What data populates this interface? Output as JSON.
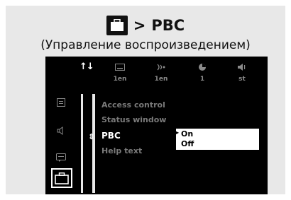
{
  "title": {
    "separator": ">",
    "label": "PBC",
    "subtitle": "(Управление воспроизведением)",
    "icon": "briefcase-icon"
  },
  "topbar": {
    "settings_label": "↑↓",
    "columns": [
      {
        "icon": "subtitle-icon",
        "value": "1en"
      },
      {
        "icon": "audio-language-icon",
        "value": "1en"
      },
      {
        "icon": "angle-icon",
        "value": "1"
      },
      {
        "icon": "sound-mode-icon",
        "value": "st"
      }
    ]
  },
  "sidebar": [
    {
      "icon": "screen-icon"
    },
    {
      "icon": "speaker-icon"
    },
    {
      "icon": "subtitle-box-icon"
    },
    {
      "icon": "briefcase-icon",
      "active": true
    }
  ],
  "menu": {
    "items": [
      "Access control",
      "Status window",
      "PBC",
      "Help text"
    ],
    "active_index": 2,
    "options": [
      "On",
      "Off"
    ],
    "selected_option": "On"
  },
  "colors": {
    "panel": "#000000",
    "frame": "#e8e8e8",
    "dim_text": "#7a7a7a",
    "highlight_box": "#ffffff"
  }
}
